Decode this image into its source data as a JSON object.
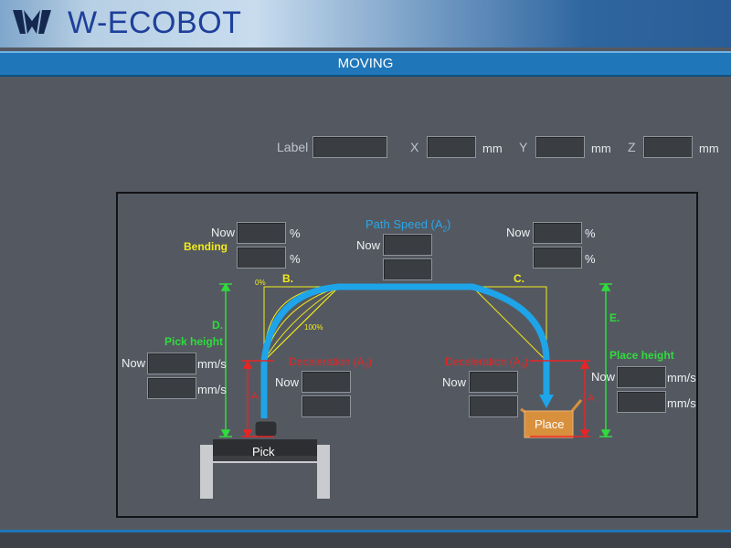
{
  "header": {
    "brand": "W-ECOBOT",
    "title": "MOVING"
  },
  "coords": {
    "label": "Label",
    "x": "X",
    "y": "Y",
    "z": "Z",
    "unit_mm": "mm",
    "label_value": "",
    "x_value": "",
    "y_value": "",
    "z_value": ""
  },
  "diagram": {
    "path_speed_prefix": "Path Speed (A",
    "path_speed_sub": "2",
    "path_speed_suffix": ")",
    "now": "Now",
    "pct": "%",
    "bending": "Bending",
    "b": "B.",
    "c": "C.",
    "d": "D.",
    "e": "E.",
    "a": "A.",
    "zero_pct": "0%",
    "hundred_pct": "100%",
    "pick_height": "Pick height",
    "place_height": "Place height",
    "decel_prefix": "Deceleration (A",
    "decel_sub": "3",
    "decel_suffix": ")",
    "mms": "mm/s",
    "pick": "Pick",
    "place": "Place"
  },
  "colors": {
    "accent_blue": "#1f76b9",
    "path_blue": "#1ea4e8",
    "yellow": "#f2ea19",
    "green": "#2fdc3c",
    "red": "#ea2424",
    "place_orange": "#d9903c"
  }
}
